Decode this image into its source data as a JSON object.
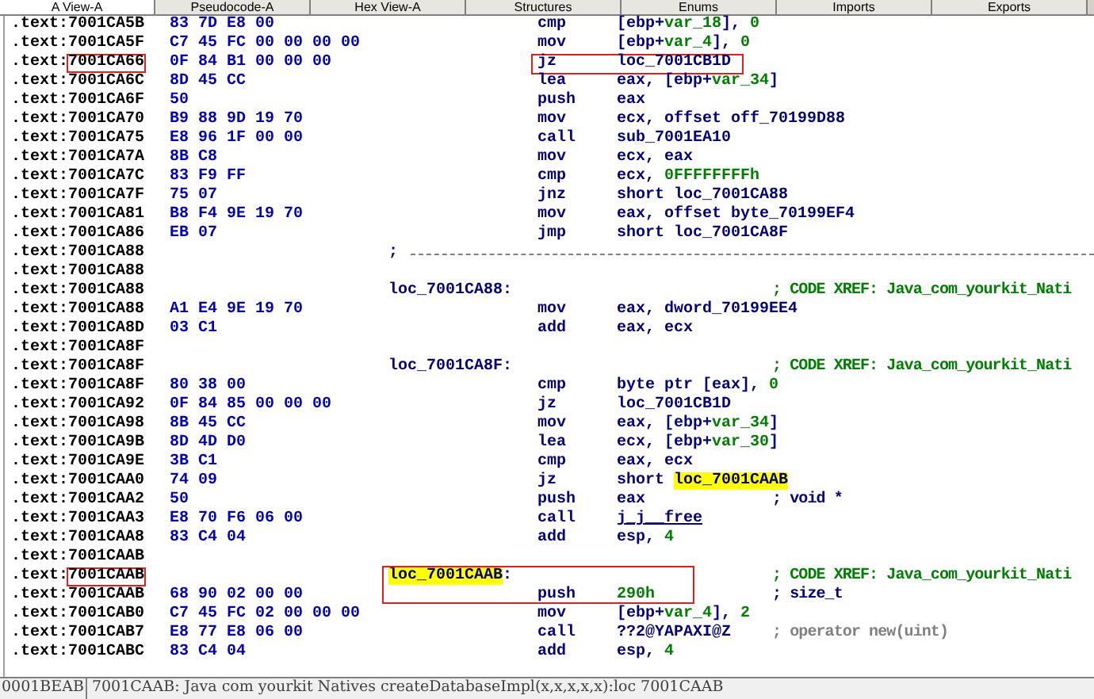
{
  "tabs": [
    {
      "label": "A View-A",
      "selected": true
    },
    {
      "label": "Pseudocode-A",
      "selected": false
    },
    {
      "label": "Hex View-A",
      "selected": false
    },
    {
      "label": "Structures",
      "selected": false
    },
    {
      "label": "Enums",
      "selected": false
    },
    {
      "label": "Imports",
      "selected": false
    },
    {
      "label": "Exports",
      "selected": false
    }
  ],
  "rows": [
    {
      "kind": "code",
      "segment": ".text:",
      "address": "7001CA5B",
      "bytes": "83 7D E8 00",
      "mnemonic": "cmp",
      "operands": [
        {
          "text": "[ebp+",
          "kind": "plain"
        },
        {
          "text": "var_18",
          "kind": "var"
        },
        {
          "text": "], ",
          "kind": "plain"
        },
        {
          "text": "0",
          "kind": "num"
        }
      ],
      "address_framed": false,
      "code_framed": false
    },
    {
      "kind": "code",
      "segment": ".text:",
      "address": "7001CA5F",
      "bytes": "C7 45 FC 00 00 00 00",
      "mnemonic": "mov",
      "operands": [
        {
          "text": "[ebp+",
          "kind": "plain"
        },
        {
          "text": "var_4",
          "kind": "var"
        },
        {
          "text": "], ",
          "kind": "plain"
        },
        {
          "text": "0",
          "kind": "num"
        }
      ],
      "address_framed": false,
      "code_framed": false
    },
    {
      "kind": "code",
      "segment": ".text:",
      "address": "7001CA66",
      "bytes": "0F 84 B1 00 00 00",
      "mnemonic": "jz",
      "operands": [
        {
          "text": "loc_7001CB1D",
          "kind": "plain"
        }
      ],
      "address_framed": true,
      "code_framed": true
    },
    {
      "kind": "code",
      "segment": ".text:",
      "address": "7001CA6C",
      "bytes": "8D 45 CC",
      "mnemonic": "lea",
      "operands": [
        {
          "text": "eax, [ebp+",
          "kind": "plain"
        },
        {
          "text": "var_34",
          "kind": "var"
        },
        {
          "text": "]",
          "kind": "plain"
        }
      ],
      "address_framed": false,
      "code_framed": false
    },
    {
      "kind": "code",
      "segment": ".text:",
      "address": "7001CA6F",
      "bytes": "50",
      "mnemonic": "push",
      "operands": [
        {
          "text": "eax",
          "kind": "plain"
        }
      ],
      "address_framed": false,
      "code_framed": false
    },
    {
      "kind": "code",
      "segment": ".text:",
      "address": "7001CA70",
      "bytes": "B9 88 9D 19 70",
      "mnemonic": "mov",
      "operands": [
        {
          "text": "ecx, offset off_70199D88",
          "kind": "plain"
        }
      ],
      "address_framed": false,
      "code_framed": false
    },
    {
      "kind": "code",
      "segment": ".text:",
      "address": "7001CA75",
      "bytes": "E8 96 1F 00 00",
      "mnemonic": "call",
      "operands": [
        {
          "text": "sub_7001EA10",
          "kind": "plain"
        }
      ],
      "address_framed": false,
      "code_framed": false
    },
    {
      "kind": "code",
      "segment": ".text:",
      "address": "7001CA7A",
      "bytes": "8B C8",
      "mnemonic": "mov",
      "operands": [
        {
          "text": "ecx, eax",
          "kind": "plain"
        }
      ],
      "address_framed": false,
      "code_framed": false
    },
    {
      "kind": "code",
      "segment": ".text:",
      "address": "7001CA7C",
      "bytes": "83 F9 FF",
      "mnemonic": "cmp",
      "operands": [
        {
          "text": "ecx, ",
          "kind": "plain"
        },
        {
          "text": "0FFFFFFFFh",
          "kind": "num"
        }
      ],
      "address_framed": false,
      "code_framed": false
    },
    {
      "kind": "code",
      "segment": ".text:",
      "address": "7001CA7F",
      "bytes": "75 07",
      "mnemonic": "jnz",
      "operands": [
        {
          "text": "short loc_7001CA88",
          "kind": "plain"
        }
      ],
      "address_framed": false,
      "code_framed": false
    },
    {
      "kind": "code",
      "segment": ".text:",
      "address": "7001CA81",
      "bytes": "B8 F4 9E 19 70",
      "mnemonic": "mov",
      "operands": [
        {
          "text": "eax, offset byte_70199EF4",
          "kind": "plain"
        }
      ],
      "address_framed": false,
      "code_framed": false
    },
    {
      "kind": "code",
      "segment": ".text:",
      "address": "7001CA86",
      "bytes": "EB 07",
      "mnemonic": "jmp",
      "operands": [
        {
          "text": "short loc_7001CA8F",
          "kind": "plain"
        }
      ],
      "address_framed": false,
      "code_framed": false
    },
    {
      "kind": "separator",
      "segment": ".text:",
      "address": "7001CA88",
      "mark": ";",
      "address_framed": false
    },
    {
      "kind": "blank",
      "segment": ".text:",
      "address": "7001CA88",
      "address_framed": false
    },
    {
      "kind": "label",
      "segment": ".text:",
      "address": "7001CA88",
      "label": [
        {
          "text": "loc_7001CA88",
          "kind": "plain"
        },
        {
          "text": ":",
          "kind": "plain"
        }
      ],
      "comment": {
        "text": "; CODE XREF: Java_com_yourkit_Nati",
        "kind": "xref"
      },
      "address_framed": false,
      "label_framed": false
    },
    {
      "kind": "code",
      "segment": ".text:",
      "address": "7001CA88",
      "bytes": "A1 E4 9E 19 70",
      "mnemonic": "mov",
      "operands": [
        {
          "text": "eax, dword_70199EE4",
          "kind": "plain"
        }
      ],
      "address_framed": false,
      "code_framed": false
    },
    {
      "kind": "code",
      "segment": ".text:",
      "address": "7001CA8D",
      "bytes": "03 C1",
      "mnemonic": "add",
      "operands": [
        {
          "text": "eax, ecx",
          "kind": "plain"
        }
      ],
      "address_framed": false,
      "code_framed": false
    },
    {
      "kind": "blank",
      "segment": ".text:",
      "address": "7001CA8F",
      "address_framed": false
    },
    {
      "kind": "label",
      "segment": ".text:",
      "address": "7001CA8F",
      "label": [
        {
          "text": "loc_7001CA8F",
          "kind": "plain"
        },
        {
          "text": ":",
          "kind": "plain"
        }
      ],
      "comment": {
        "text": "; CODE XREF: Java_com_yourkit_Nati",
        "kind": "xref"
      },
      "address_framed": false,
      "label_framed": false
    },
    {
      "kind": "code",
      "segment": ".text:",
      "address": "7001CA8F",
      "bytes": "80 38 00",
      "mnemonic": "cmp",
      "operands": [
        {
          "text": "byte ptr [eax], ",
          "kind": "plain"
        },
        {
          "text": "0",
          "kind": "num"
        }
      ],
      "address_framed": false,
      "code_framed": false
    },
    {
      "kind": "code",
      "segment": ".text:",
      "address": "7001CA92",
      "bytes": "0F 84 85 00 00 00",
      "mnemonic": "jz",
      "operands": [
        {
          "text": "loc_7001CB1D",
          "kind": "plain"
        }
      ],
      "address_framed": false,
      "code_framed": false
    },
    {
      "kind": "code",
      "segment": ".text:",
      "address": "7001CA98",
      "bytes": "8B 45 CC",
      "mnemonic": "mov",
      "operands": [
        {
          "text": "eax, [ebp+",
          "kind": "plain"
        },
        {
          "text": "var_34",
          "kind": "var"
        },
        {
          "text": "]",
          "kind": "plain"
        }
      ],
      "address_framed": false,
      "code_framed": false
    },
    {
      "kind": "code",
      "segment": ".text:",
      "address": "7001CA9B",
      "bytes": "8D 4D D0",
      "mnemonic": "lea",
      "operands": [
        {
          "text": "ecx, [ebp+",
          "kind": "plain"
        },
        {
          "text": "var_30",
          "kind": "var"
        },
        {
          "text": "]",
          "kind": "plain"
        }
      ],
      "address_framed": false,
      "code_framed": false
    },
    {
      "kind": "code",
      "segment": ".text:",
      "address": "7001CA9E",
      "bytes": "3B C1",
      "mnemonic": "cmp",
      "operands": [
        {
          "text": "eax, ecx",
          "kind": "plain"
        }
      ],
      "address_framed": false,
      "code_framed": false
    },
    {
      "kind": "code",
      "segment": ".text:",
      "address": "7001CAA0",
      "bytes": "74 09",
      "mnemonic": "jz",
      "operands": [
        {
          "text": "short ",
          "kind": "plain"
        },
        {
          "text": "loc_7001CAAB",
          "kind": "highlight"
        }
      ],
      "address_framed": false,
      "code_framed": false
    },
    {
      "kind": "code",
      "segment": ".text:",
      "address": "7001CAA2",
      "bytes": "50",
      "mnemonic": "push",
      "operands": [
        {
          "text": "eax",
          "kind": "plain"
        }
      ],
      "comment": {
        "text": "; void *",
        "kind": "type"
      },
      "address_framed": false,
      "code_framed": false
    },
    {
      "kind": "code",
      "segment": ".text:",
      "address": "7001CAA3",
      "bytes": "E8 70 F6 06 00",
      "mnemonic": "call",
      "operands": [
        {
          "text": "j_j__free",
          "kind": "link"
        }
      ],
      "address_framed": false,
      "code_framed": false
    },
    {
      "kind": "code",
      "segment": ".text:",
      "address": "7001CAA8",
      "bytes": "83 C4 04",
      "mnemonic": "add",
      "operands": [
        {
          "text": "esp, ",
          "kind": "plain"
        },
        {
          "text": "4",
          "kind": "num"
        }
      ],
      "address_framed": false,
      "code_framed": false
    },
    {
      "kind": "blank",
      "segment": ".text:",
      "address": "7001CAAB",
      "address_framed": false
    },
    {
      "kind": "label",
      "segment": ".text:",
      "address": "7001CAAB",
      "label": [
        {
          "text": "loc_7001CAAB",
          "kind": "highlight"
        },
        {
          "text": ":",
          "kind": "plain"
        }
      ],
      "comment": {
        "text": "; CODE XREF: Java_com_yourkit_Nati",
        "kind": "xref"
      },
      "address_framed": true,
      "label_framed": true
    },
    {
      "kind": "code",
      "segment": ".text:",
      "address": "7001CAAB",
      "bytes": "68 90 02 00 00",
      "mnemonic": "push",
      "operands": [
        {
          "text": "290h",
          "kind": "num"
        }
      ],
      "comment": {
        "text": "; size_t",
        "kind": "type"
      },
      "address_framed": false,
      "code_framed": false
    },
    {
      "kind": "code",
      "segment": ".text:",
      "address": "7001CAB0",
      "bytes": "C7 45 FC 02 00 00 00",
      "mnemonic": "mov",
      "operands": [
        {
          "text": "[ebp+",
          "kind": "plain"
        },
        {
          "text": "var_4",
          "kind": "var"
        },
        {
          "text": "], ",
          "kind": "plain"
        },
        {
          "text": "2",
          "kind": "num"
        }
      ],
      "address_framed": false,
      "code_framed": false
    },
    {
      "kind": "code",
      "segment": ".text:",
      "address": "7001CAB7",
      "bytes": "E8 77 E8 06 00",
      "mnemonic": "call",
      "operands": [
        {
          "text": "??2@YAPAXI@Z",
          "kind": "plain"
        }
      ],
      "comment": {
        "text": "; operator new(uint)",
        "kind": "auto"
      },
      "address_framed": false,
      "code_framed": false
    },
    {
      "kind": "code",
      "segment": ".text:",
      "address": "7001CABC",
      "bytes": "83 C4 04",
      "mnemonic": "add",
      "operands": [
        {
          "text": "esp, ",
          "kind": "plain"
        },
        {
          "text": "4",
          "kind": "num"
        }
      ],
      "address_framed": false,
      "code_framed": false
    }
  ],
  "status_bar": {
    "offset": "0001BEAB",
    "location": "7001CAAB: Java com yourkit Natives createDatabaseImpl(x,x,x,x,x):loc 7001CAAB"
  }
}
